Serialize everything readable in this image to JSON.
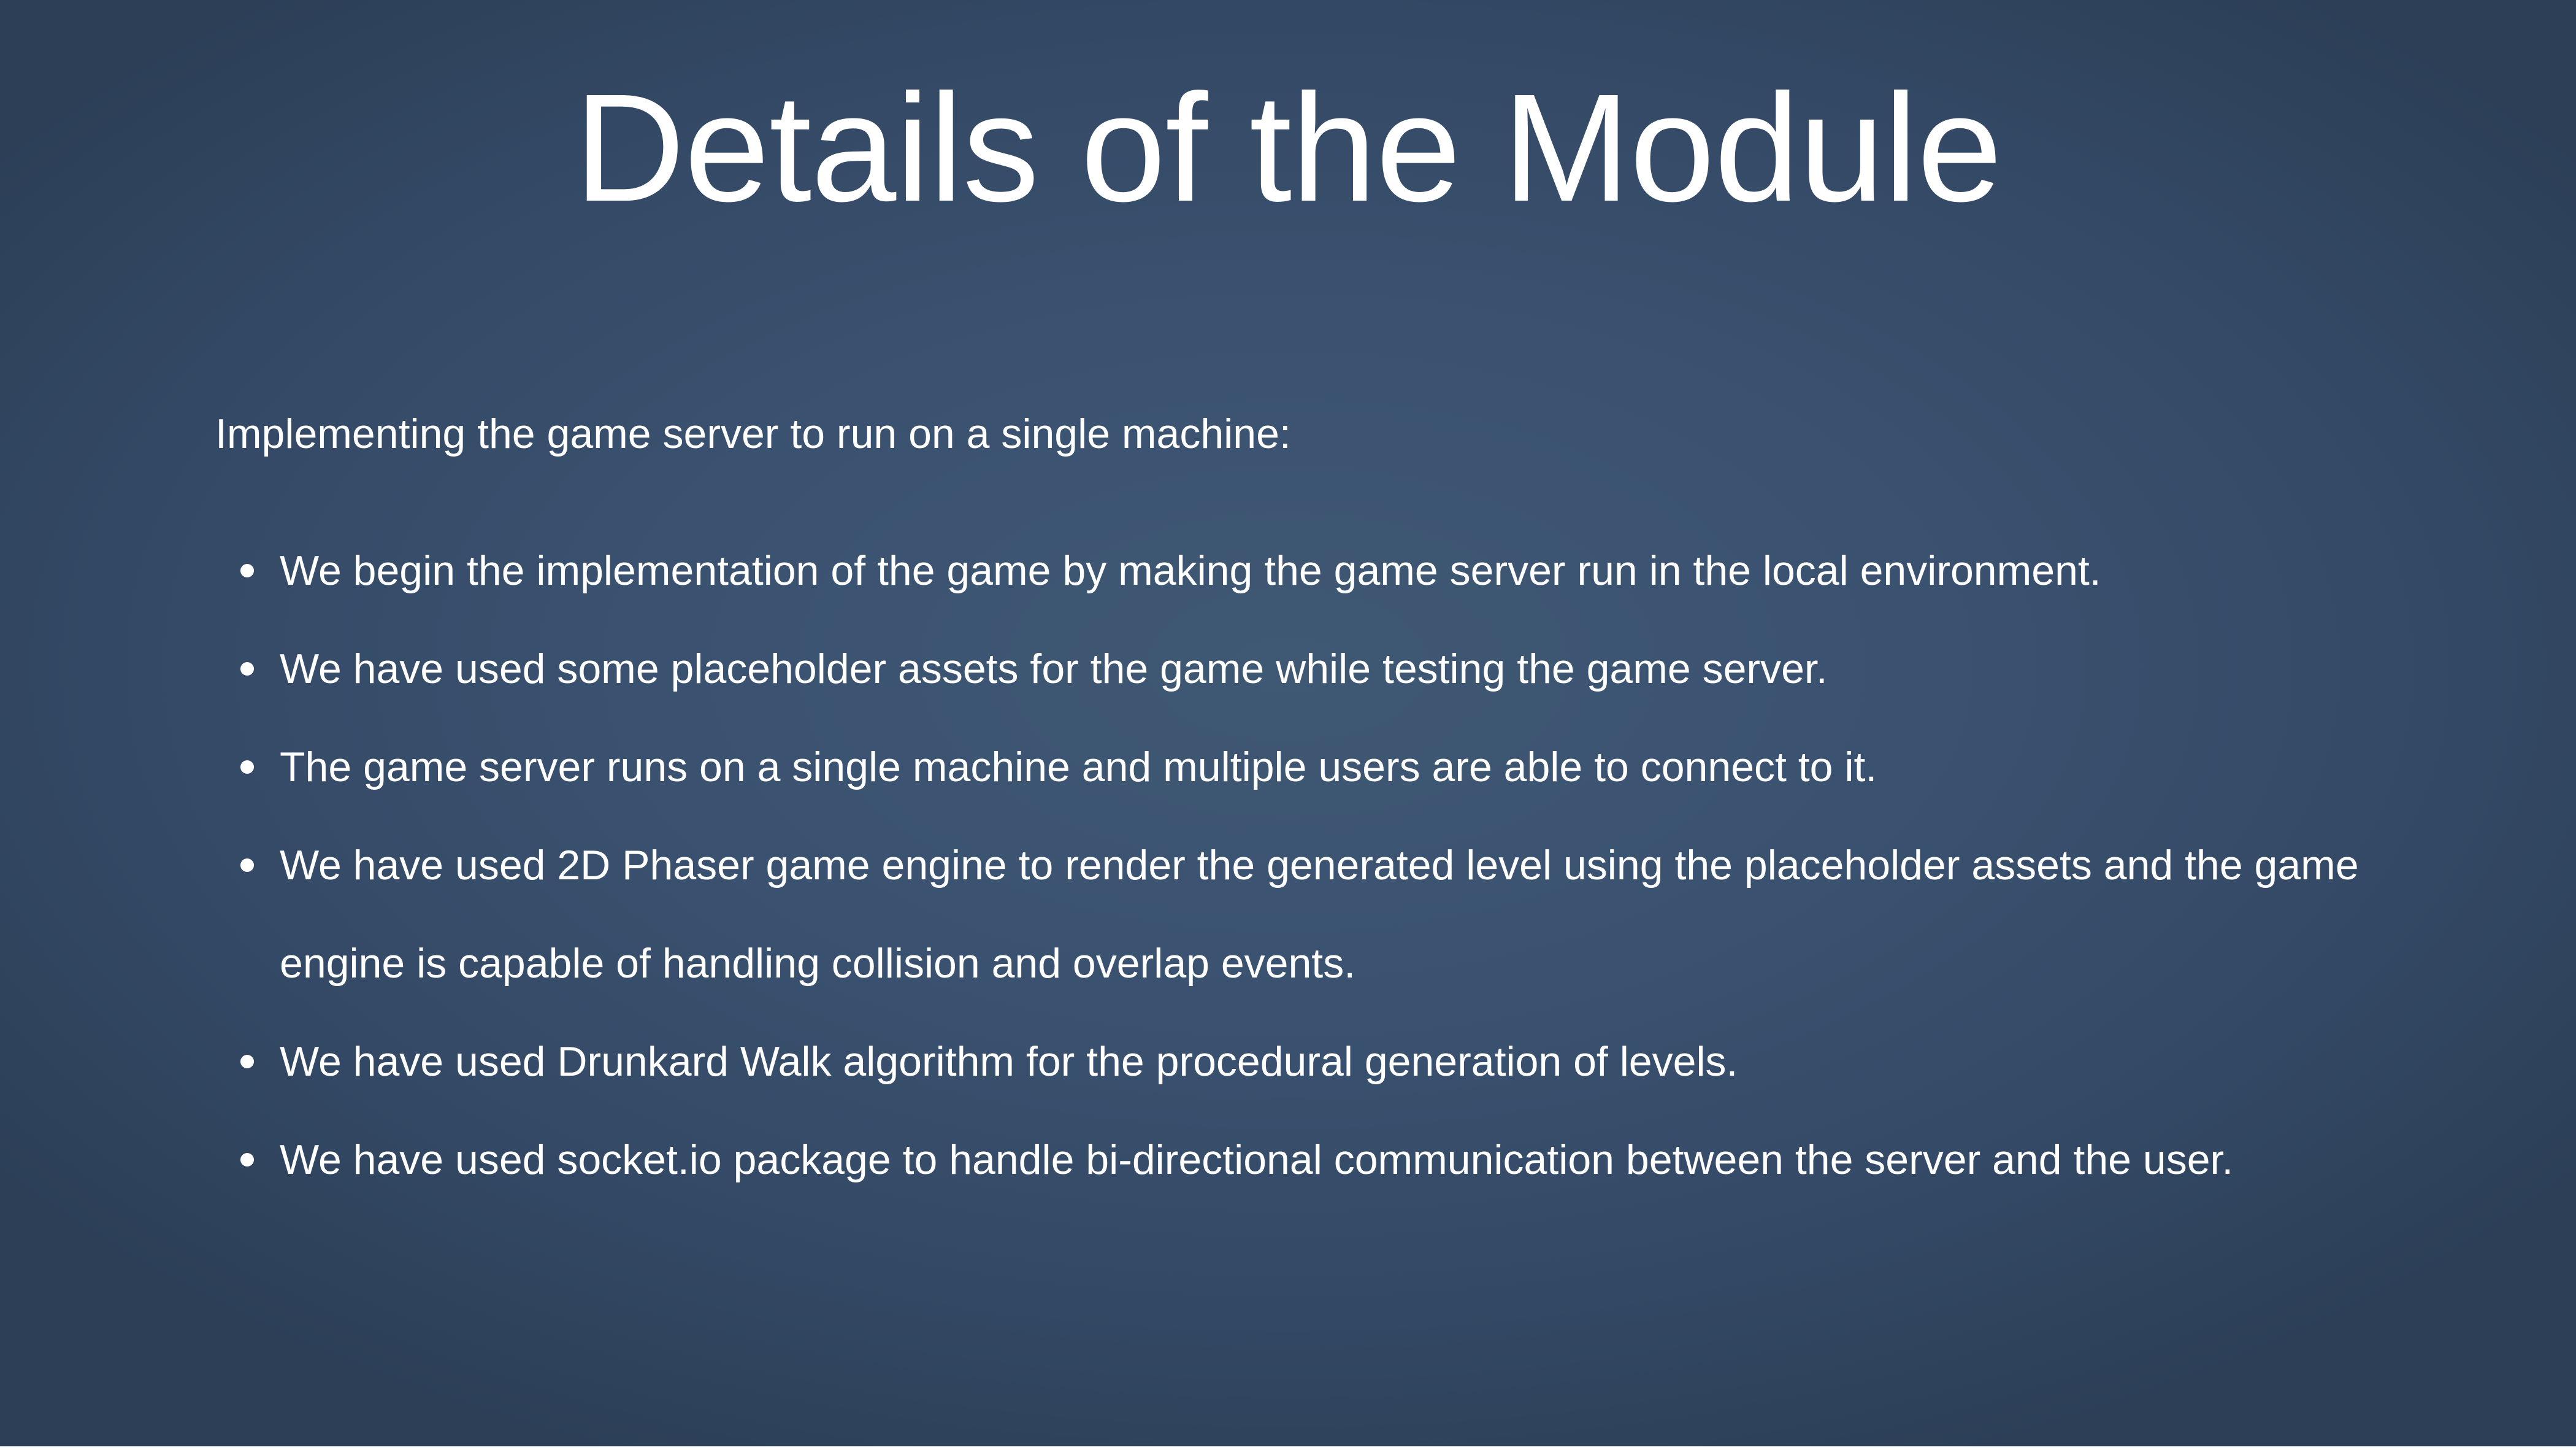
{
  "slide": {
    "title": "Details of the Module",
    "intro": "Implementing the game server to run on a single machine:",
    "bullets": [
      "We begin the implementation of the game by making the game server run in the local environment.",
      "We have used some placeholder assets for the game while testing the game server.",
      "The game server runs on a single machine and multiple users are able to connect to it.",
      "We have used 2D Phaser game engine to render the generated level using the placeholder assets and the game engine is capable of handling collision and overlap events.",
      "We have used Drunkard Walk algorithm for the procedural generation of levels.",
      "We have used socket.io package to handle bi-directional communication between the server and the user."
    ]
  },
  "colors": {
    "background_center": "#3f5873",
    "background_edge": "#2c3f57",
    "text": "#ffffff"
  }
}
